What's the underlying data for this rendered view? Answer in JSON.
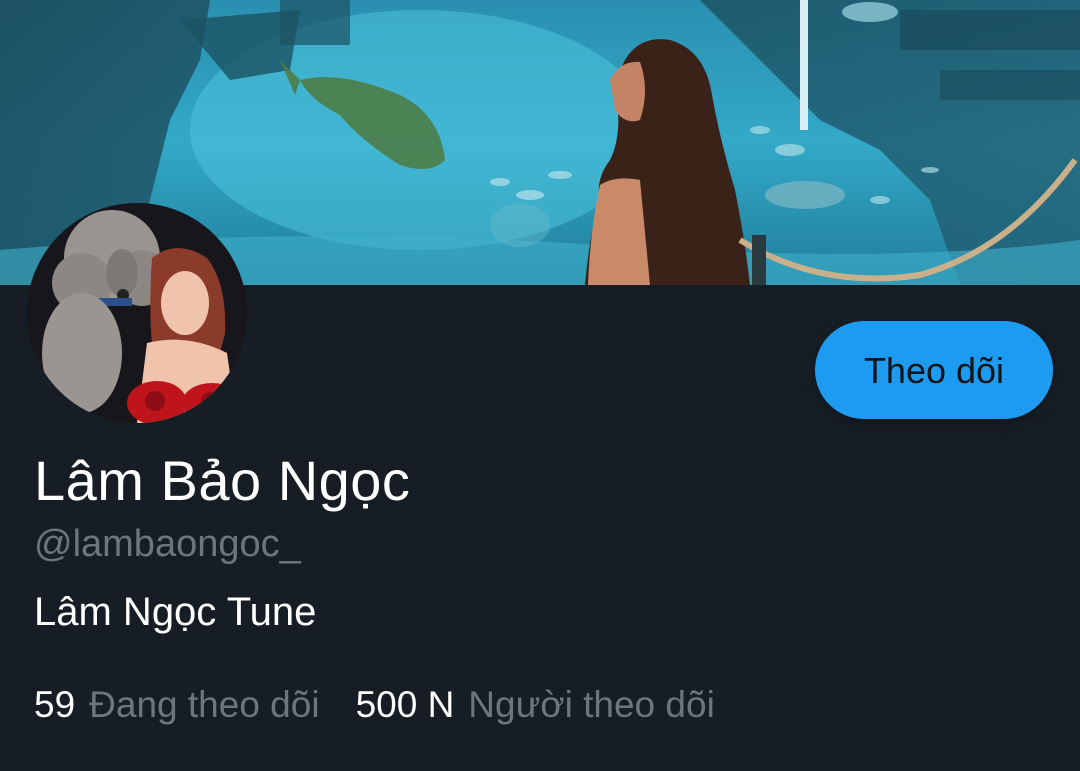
{
  "profile": {
    "display_name": "Lâm Bảo Ngọc",
    "handle": "@lambaongoc_",
    "bio": "Lâm Ngọc Tune"
  },
  "follow_button": {
    "label": "Theo dõi"
  },
  "stats": {
    "following_count": "59",
    "following_label": "Đang theo dõi",
    "followers_count": "500 N",
    "followers_label": "Người theo dõi"
  },
  "colors": {
    "background": "#161d24",
    "accent": "#1d9bf0",
    "secondary_text": "#6e767d",
    "primary_text": "#ffffff"
  }
}
